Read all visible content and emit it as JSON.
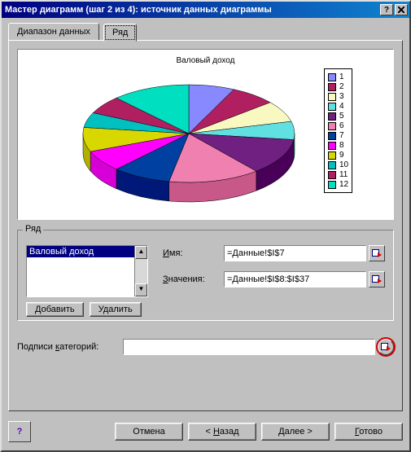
{
  "window": {
    "title": "Мастер диаграмм (шаг 2 из 4): источник данных диаграммы"
  },
  "tabs": {
    "data_range": "Диапазон данных",
    "series": "Ряд"
  },
  "chart_data": {
    "type": "pie",
    "title": "Валовый доход",
    "categories": [
      "1",
      "2",
      "3",
      "4",
      "5",
      "6",
      "7",
      "8",
      "9",
      "10",
      "11",
      "12"
    ],
    "values": [
      7,
      7,
      7,
      6,
      12,
      14,
      9,
      7,
      8,
      5,
      6,
      12
    ],
    "colors": [
      "#8888ff",
      "#b02060",
      "#f8f8c0",
      "#60e0e0",
      "#702080",
      "#f080b0",
      "#0040a0",
      "#ff00ff",
      "#d8d800",
      "#00c0c0",
      "#b02060",
      "#00e0c0"
    ],
    "legend_entries": [
      "1",
      "2",
      "3",
      "4",
      "5",
      "6",
      "7",
      "8",
      "9",
      "10",
      "11",
      "12"
    ],
    "legend_position": "right"
  },
  "group": {
    "title": "Ряд",
    "list_items": [
      "Валовый доход"
    ],
    "add_label": "Добавить",
    "remove_label": "Удалить",
    "name_label": "Имя:",
    "name_value": "=Данные!$I$7",
    "values_label": "Значения:",
    "values_value": "=Данные!$I$8:$I$37"
  },
  "categories": {
    "label": "Подписи категорий:",
    "value": ""
  },
  "footer": {
    "help": "?",
    "cancel": "Отмена",
    "back": "< Назад",
    "next": "Далее >",
    "finish": "Готово"
  }
}
